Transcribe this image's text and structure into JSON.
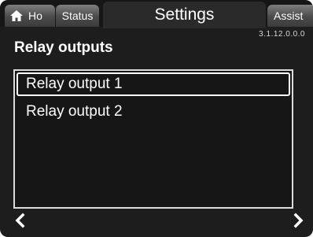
{
  "tabs": {
    "home_label": "Ho",
    "status_label": "Status",
    "settings_label": "Settings",
    "assist_label": "Assist"
  },
  "version": "3.1.12.0.0.0",
  "page_title": "Relay outputs",
  "list": {
    "items": [
      {
        "label": "Relay output 1",
        "selected": true
      },
      {
        "label": "Relay output 2",
        "selected": false
      }
    ]
  },
  "icons": {
    "home": "home-icon",
    "prev": "chevron-left-icon",
    "next": "chevron-right-icon"
  },
  "colors": {
    "background": "#1d1d1d",
    "text": "#ffffff",
    "selection_border": "#ffffff"
  }
}
